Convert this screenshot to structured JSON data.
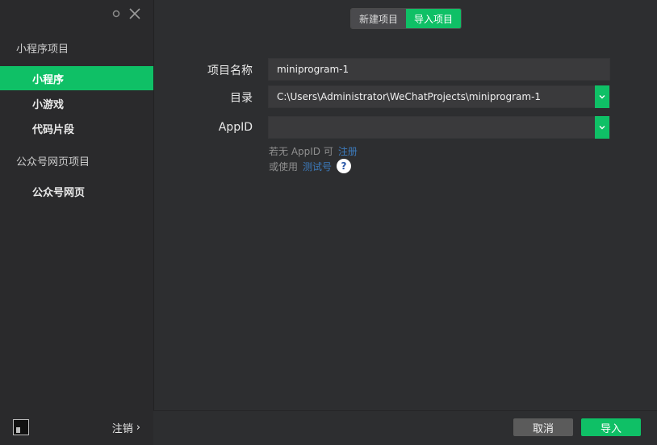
{
  "sidebar": {
    "sections": [
      {
        "title": "小程序项目"
      },
      {
        "title": "公众号网页项目"
      }
    ],
    "items": [
      {
        "label": "小程序",
        "active": true
      },
      {
        "label": "小游戏",
        "active": false
      },
      {
        "label": "代码片段",
        "active": false
      },
      {
        "label": "公众号网页",
        "active": false
      }
    ],
    "logout_label": "注销"
  },
  "tabs": {
    "new_project": "新建项目",
    "import_project": "导入项目",
    "active": "import_project"
  },
  "form": {
    "project_name_label": "项目名称",
    "project_name_value": "miniprogram-1",
    "directory_label": "目录",
    "directory_value": "C:\\Users\\Administrator\\WeChatProjects\\miniprogram-1",
    "appid_label": "AppID",
    "appid_value": "",
    "help1_text": "若无 AppID 可",
    "help1_link": "注册",
    "help2_text": "或使用",
    "help2_link": "测试号",
    "help_icon": "?"
  },
  "footer": {
    "cancel": "取消",
    "import": "导入"
  },
  "colors": {
    "accent": "#0fc066",
    "background": "#2d2e30",
    "sidebar": "#2a2a2c",
    "link": "#3c7bbd"
  },
  "icons": {
    "settings": "settings-icon",
    "close": "close-icon",
    "dropdown": "chevron-down-icon",
    "help": "help-icon",
    "logout_chevron": "chevron-right-icon"
  }
}
